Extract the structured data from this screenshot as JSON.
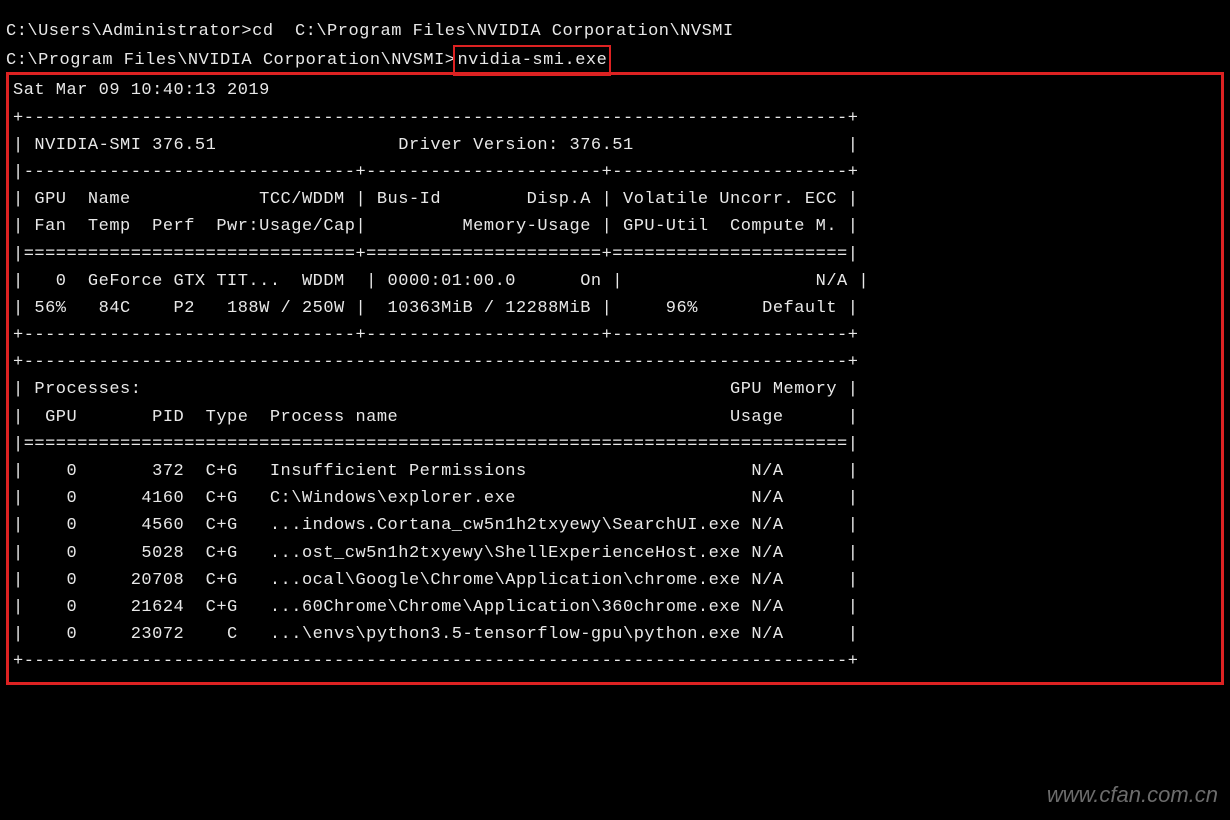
{
  "prompts": {
    "cd_line_prompt": "C:\\Users\\Administrator>",
    "cd_line_cmd": "cd  C:\\Program Files\\NVIDIA Corporation\\NVSMI",
    "smi_prompt": "C:\\Program Files\\NVIDIA Corporation\\NVSMI>",
    "smi_cmd": "nvidia-smi.exe"
  },
  "smi": {
    "timestamp": "Sat Mar 09 10:40:13 2019",
    "version_line": "| NVIDIA-SMI 376.51                 Driver Version: 376.51                    |",
    "hdr1": "| GPU  Name            TCC/WDDM | Bus-Id        Disp.A | Volatile Uncorr. ECC |",
    "hdr2": "| Fan  Temp  Perf  Pwr:Usage/Cap|         Memory-Usage | GPU-Util  Compute M. |",
    "gpu_row1": "|   0  GeForce GTX TIT...  WDDM  | 0000:01:00.0      On |                  N/A |",
    "gpu_row2": "| 56%   84C    P2   188W / 250W |  10363MiB / 12288MiB |     96%      Default |",
    "proc_hdr1": "| Processes:                                                       GPU Memory |",
    "proc_hdr2": "|  GPU       PID  Type  Process name                               Usage      |",
    "proc_rows": [
      "|    0       372  C+G   Insufficient Permissions                     N/A      |",
      "|    0      4160  C+G   C:\\Windows\\explorer.exe                      N/A      |",
      "|    0      4560  C+G   ...indows.Cortana_cw5n1h2txyewy\\SearchUI.exe N/A      |",
      "|    0      5028  C+G   ...ost_cw5n1h2txyewy\\ShellExperienceHost.exe N/A      |",
      "|    0     20708  C+G   ...ocal\\Google\\Chrome\\Application\\chrome.exe N/A      |",
      "|    0     21624  C+G   ...60Chrome\\Chrome\\Application\\360chrome.exe N/A      |",
      "|    0     23072    C   ...\\envs\\python3.5-tensorflow-gpu\\python.exe N/A      |"
    ],
    "sep_top": "+-----------------------------------------------------------------------------+",
    "sep_mid3": "|-------------------------------+----------------------+----------------------+",
    "sep_eq3": "|===============================+======================+======================|",
    "sep_plus3": "+-------------------------------+----------------------+----------------------+",
    "sep_eq1": "|=============================================================================|",
    "sep_bottom": "+-----------------------------------------------------------------------------+",
    "blank": ""
  },
  "watermark": "www.cfan.com.cn"
}
